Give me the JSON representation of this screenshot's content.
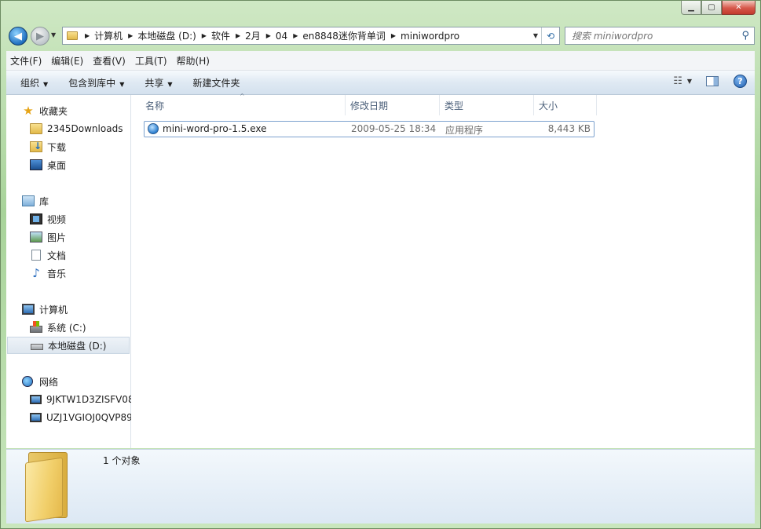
{
  "window": {
    "caption": {
      "min": "▁",
      "max": "▢",
      "close": "✕"
    }
  },
  "nav": {
    "back_glyph": "◀",
    "forward_glyph": "▶",
    "recent_glyph": "▼",
    "breadcrumb": [
      "计算机",
      "本地磁盘 (D:)",
      "软件",
      "2月",
      "04",
      "en8848迷你背单词",
      "miniwordpro"
    ],
    "separator": "▶",
    "dropdown_glyph": "▼",
    "refresh_glyph": "⟲",
    "search_placeholder": "搜索 miniwordpro",
    "search_icon": "⚲"
  },
  "menubar": [
    "文件(F)",
    "编辑(E)",
    "查看(V)",
    "工具(T)",
    "帮助(H)"
  ],
  "toolbar": {
    "organize": "组织",
    "include_in_library": "包含到库中",
    "share": "共享",
    "new_folder": "新建文件夹",
    "caret": "▼",
    "view_glyph": "☷",
    "help_glyph": "?"
  },
  "sidebar": {
    "favorites": {
      "label": "收藏夹",
      "icon": "star-icon",
      "items": [
        "2345Downloads",
        "下载",
        "桌面"
      ]
    },
    "libraries": {
      "label": "库",
      "items": [
        "视频",
        "图片",
        "文档",
        "音乐"
      ]
    },
    "computer": {
      "label": "计算机",
      "items": [
        "系统 (C:)",
        "本地磁盘 (D:)"
      ],
      "selected": "本地磁盘 (D:)"
    },
    "network": {
      "label": "网络",
      "items": [
        "9JKTW1D3ZISFV08",
        "UZJ1VGIOJ0QVP89"
      ]
    }
  },
  "columns": {
    "name": "名称",
    "date": "修改日期",
    "type": "类型",
    "size": "大小",
    "sort_glyph": "^"
  },
  "files": [
    {
      "name": "mini-word-pro-1.5.exe",
      "date": "2009-05-25 18:34",
      "type": "应用程序",
      "size": "8,443 KB"
    }
  ],
  "details": {
    "count": "1 个对象"
  },
  "colors": {
    "accent": "#1f6fbf",
    "aero_frame": "#a8d39a",
    "selection_border": "#7da2ce",
    "header_text": "#4c607a"
  }
}
